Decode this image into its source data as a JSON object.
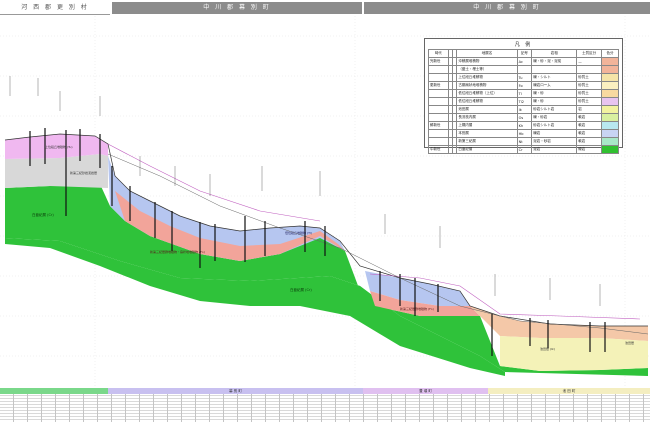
{
  "header": {
    "left_label": "河 西 郡 更 別 村",
    "mid_label": "中 川 郡 幕 別 町",
    "mid2_label": "中 川 郡 幕 別 町"
  },
  "legend": {
    "title": "凡 例",
    "headers": [
      "時代",
      "",
      "",
      "地層名",
      "記号",
      "岩相",
      "土質区分",
      "色分"
    ],
    "rows": [
      {
        "era": "完新世",
        "name": "沖積層堆積物",
        "code": "Ac",
        "lith": "礫・砂・泥・泥炭",
        "soil": "—",
        "color": "#f2b49a"
      },
      {
        "era": "",
        "name": "（盛土・埋土等）",
        "code": "",
        "lith": "",
        "soil": "",
        "color": "#f2b49a"
      },
      {
        "era": "",
        "name": "上位段丘堆積物",
        "code": "Tu",
        "lith": "礫・シルト",
        "soil": "砂質土",
        "color": "#f5e4a8"
      },
      {
        "era": "更新世",
        "name": "古期扇状地堆積物",
        "code": "Fo",
        "lith": "礫岩ローム",
        "soil": "砂質土",
        "color": "#fbf0c0"
      },
      {
        "era": "",
        "name": "低位段丘堆積物（上位）",
        "code": "Tl",
        "lith": "礫・砂",
        "soil": "砂質土",
        "color": "#f8d9a0"
      },
      {
        "era": "",
        "name": "低位段丘堆積物",
        "code": "Tl2",
        "lith": "礫・砂",
        "soil": "砂質土",
        "color": "#e8c4f0"
      },
      {
        "era": "",
        "name": "池田層",
        "code": "Ik",
        "lith": "砂岩シルト岩",
        "soil": "岩",
        "color": "#f2f2a0"
      },
      {
        "era": "",
        "name": "長流枝内層",
        "code": "Os",
        "lith": "礫・砂岩",
        "soil": "軟岩",
        "color": "#d9f0a0"
      },
      {
        "era": "鮮新世",
        "name": "上幌内層",
        "code": "Kh",
        "lith": "砂岩シルト岩",
        "soil": "軟岩",
        "color": "#b8e8f0"
      },
      {
        "era": "",
        "name": "本別層",
        "code": "Hb",
        "lith": "礫岩",
        "soil": "軟岩",
        "color": "#c8d4f4"
      },
      {
        "era": "",
        "name": "新第三紀層",
        "code": "Nt",
        "lith": "泥岩・砂岩",
        "soil": "軟岩",
        "color": "#a8e8c8"
      },
      {
        "era": "中新世",
        "name": "白亜紀層",
        "code": "Cr",
        "lith": "泥岩",
        "soil": "硬岩",
        "color": "#30c030"
      }
    ]
  },
  "bottom_bar": {
    "seg1": "",
    "seg2": "幕 別 町",
    "seg3": "豊 頃 町",
    "seg4": "池 田 町"
  },
  "labels": {
    "green_main": "白亜紀層 (Cr)",
    "red_mid": "新第三紀層群堆積物・扇状地堆積物 (Fo)",
    "green_right": "白亜紀層 (Cr)",
    "left_grey": "新第三紀砂岩泥岩層",
    "left_pink": "上位段丘堆積物 (Tu)",
    "blue_mid": "低位段丘堆積物 (Tl)",
    "right_yellow": "池田層 (Ik)",
    "right_salmon": "新第三紀層群堆積物 (Fo)",
    "right_end": "池田層"
  },
  "colors": {
    "green": "#2fc23a",
    "salmon": "#f2a49a",
    "blue": "#b6c6f0",
    "pink": "#f0b8f0",
    "grey": "#d8d8d8",
    "yellow": "#f4f2b8",
    "peach": "#f4c8a8"
  }
}
